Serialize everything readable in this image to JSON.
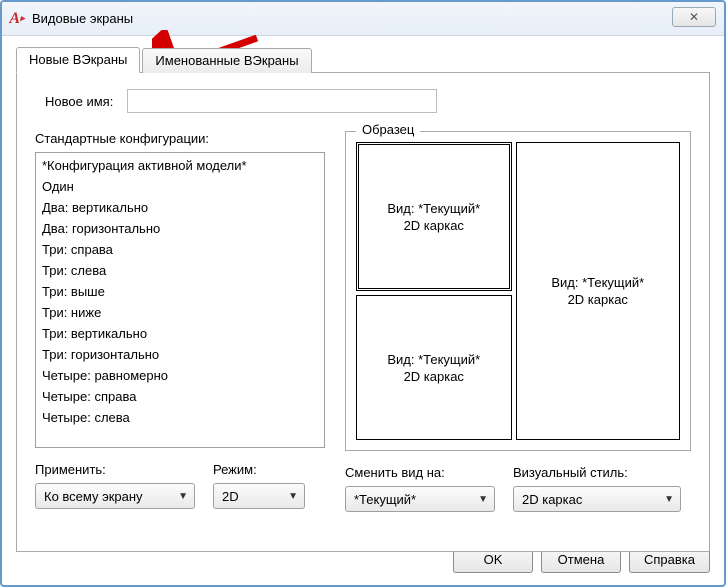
{
  "window": {
    "title": "Видовые экраны",
    "close_glyph": "✕"
  },
  "tabs": {
    "new": "Новые ВЭкраны",
    "named": "Именованные ВЭкраны"
  },
  "body": {
    "new_name_label": "Новое имя:",
    "new_name_value": "",
    "config_label": "Стандартные конфигурации:",
    "configs": [
      "*Конфигурация активной модели*",
      "Один",
      "Два: вертикально",
      "Два: горизонтально",
      "Три: справа",
      "Три: слева",
      "Три: выше",
      "Три: ниже",
      "Три: вертикально",
      "Три: горизонтально",
      "Четыре: равномерно",
      "Четыре: справа",
      "Четыре: слева"
    ],
    "preview_label": "Образец",
    "preview_view_line1": "Вид: *Текущий*",
    "preview_view_line2": "2D каркас",
    "apply_label": "Применить:",
    "apply_value": "Ко всему экрану",
    "mode_label": "Режим:",
    "mode_value": "2D",
    "changeview_label": "Сменить вид на:",
    "changeview_value": "*Текущий*",
    "vstyle_label": "Визуальный стиль:",
    "vstyle_value": "2D каркас"
  },
  "buttons": {
    "ok": "OK",
    "cancel": "Отмена",
    "help": "Справка"
  }
}
